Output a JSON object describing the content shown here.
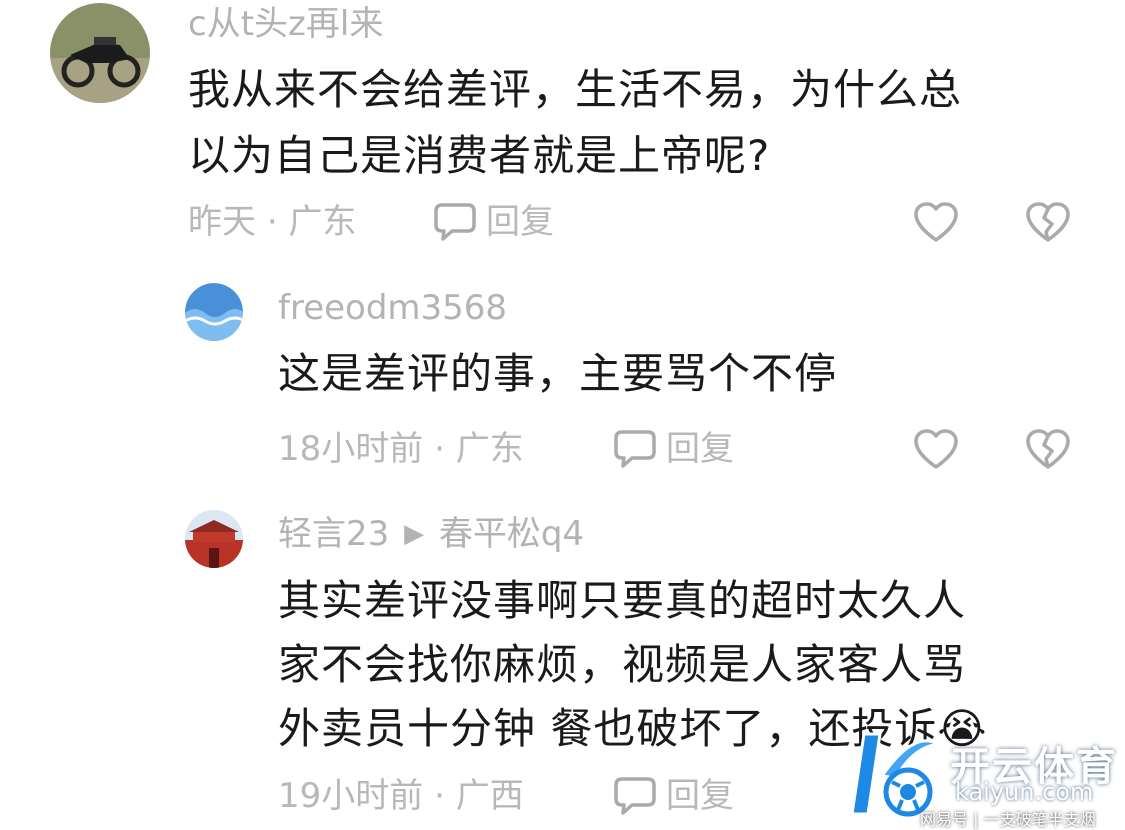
{
  "comments": [
    {
      "username": "c从t头z再l来",
      "lines": [
        "我从来不会给差评，生活不易，为什么总",
        "以为自己是消费者就是上帝呢?"
      ],
      "time": "昨天",
      "separator": "·",
      "location": "广东",
      "reply_label": "回复",
      "avatar_icon": "motorcycle-avatar"
    },
    {
      "username": "freeodm3568",
      "lines": [
        "这是差评的事，主要骂个不停"
      ],
      "time": "18小时前",
      "separator": "·",
      "location": "广东",
      "reply_label": "回复",
      "avatar_icon": "blue-wave-avatar"
    },
    {
      "username": "轻言23",
      "reply_to_arrow": "▶",
      "reply_to": "春平松q4",
      "lines": [
        "其实差评没事啊只要真的超时太久人",
        "家不会找你麻烦，视频是人家客人骂",
        "外卖员十分钟 餐也破坏了，还投诉"
      ],
      "emoji": "😭",
      "time": "19小时前",
      "separator": "·",
      "location": "广西",
      "reply_label": "回复",
      "avatar_icon": "red-building-avatar"
    }
  ],
  "icons": {
    "reply": "speech-bubble-icon",
    "like": "heart-icon",
    "dislike": "broken-heart-icon"
  },
  "watermark": {
    "brand": "开云体育",
    "domain": "kaiyun.com",
    "source": "网易号 | 一支破笔半支烟"
  },
  "colors": {
    "text": "#1a1a1a",
    "muted": "#b3b3b3",
    "icon": "#aaaaaa",
    "watermark_blue": "#1e88e5"
  }
}
